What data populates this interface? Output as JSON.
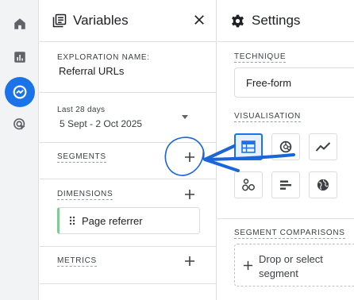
{
  "rail": {
    "items": [
      {
        "icon": "home-icon"
      },
      {
        "icon": "reports-icon"
      },
      {
        "icon": "explore-icon",
        "active": true
      },
      {
        "icon": "advertising-icon"
      }
    ]
  },
  "variables": {
    "title": "Variables",
    "exploration_name_label": "EXPLORATION NAME:",
    "exploration_name": "Referral URLs",
    "date_label": "Last 28 days",
    "date_range": "5 Sept - 2 Oct 2025",
    "segments_label": "SEGMENTS",
    "dimensions_label": "DIMENSIONS",
    "dimension_item": "Page referrer",
    "metrics_label": "METRICS"
  },
  "settings": {
    "title": "Settings",
    "technique_label": "TECHNIQUE",
    "technique_value": "Free-form",
    "visualisation_label": "VISUALISATION",
    "segment_comparisons_label": "SEGMENT COMPARISONS",
    "drop_line1": "Drop or select",
    "drop_line2": "segment"
  },
  "colors": {
    "accent": "#1a73e8",
    "dimension_bar": "#81c995",
    "annotation": "#1a66d9"
  }
}
